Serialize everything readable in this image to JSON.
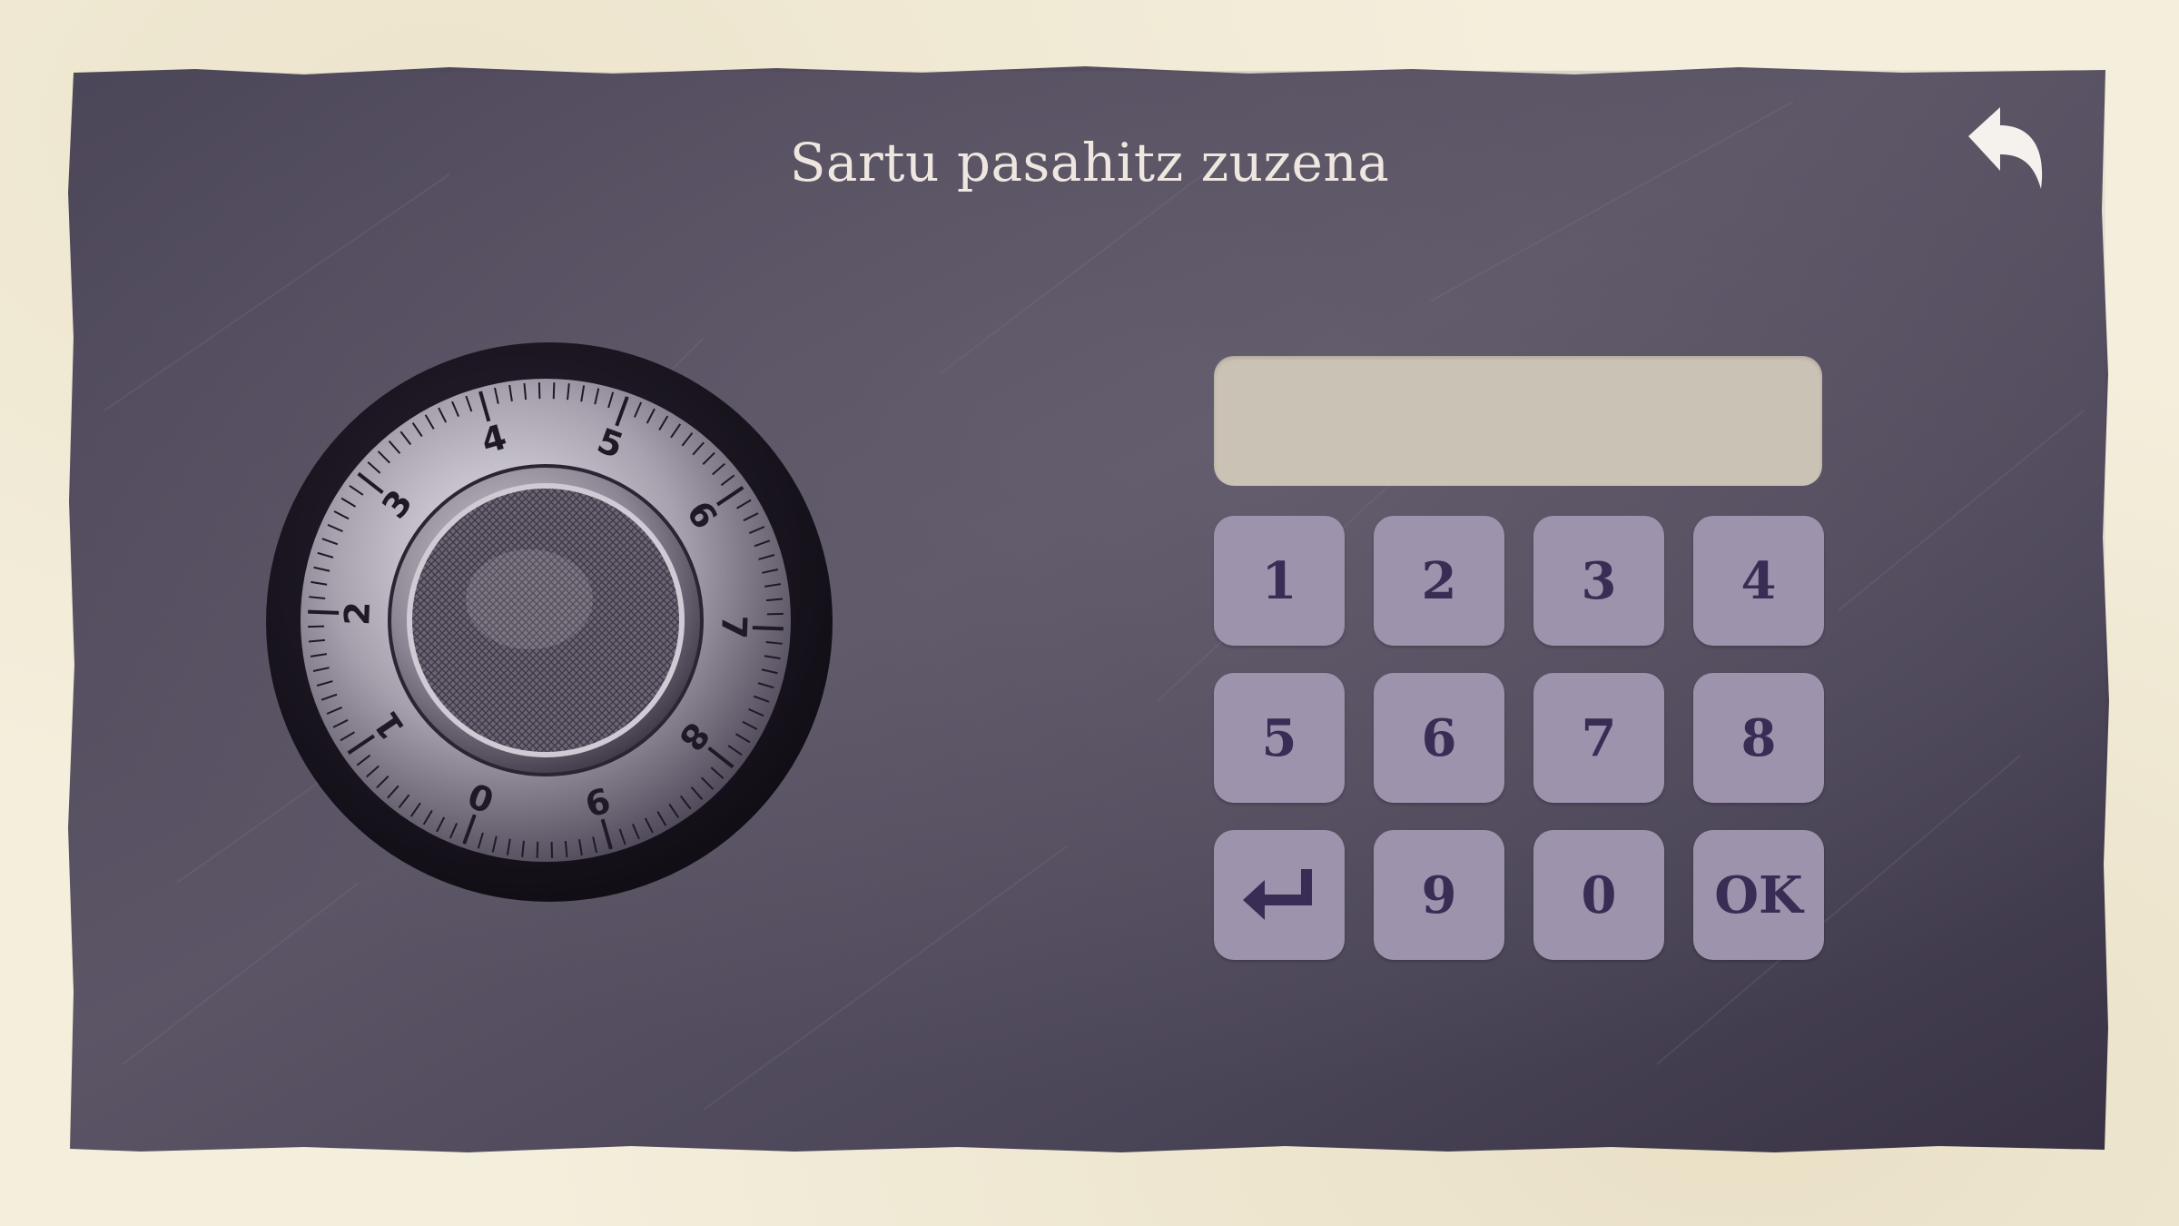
{
  "screen": {
    "title": "Sartu pasahitz zuzena",
    "back_icon": "undo-arrow-icon"
  },
  "display": {
    "value": ""
  },
  "keypad": {
    "keys": [
      {
        "label": "1",
        "name": "key-1"
      },
      {
        "label": "2",
        "name": "key-2"
      },
      {
        "label": "3",
        "name": "key-3"
      },
      {
        "label": "4",
        "name": "key-4"
      },
      {
        "label": "5",
        "name": "key-5"
      },
      {
        "label": "6",
        "name": "key-6"
      },
      {
        "label": "7",
        "name": "key-7"
      },
      {
        "label": "8",
        "name": "key-8"
      },
      {
        "label": "",
        "name": "key-backspace",
        "icon": "enter-arrow-icon"
      },
      {
        "label": "9",
        "name": "key-9"
      },
      {
        "label": "0",
        "name": "key-0"
      },
      {
        "label": "OK",
        "name": "key-ok"
      }
    ]
  },
  "dial": {
    "numbers": [
      "0",
      "1",
      "2",
      "3",
      "4",
      "5",
      "6",
      "7",
      "8",
      "9"
    ]
  },
  "colors": {
    "panel": "#4a4458",
    "paper": "#f3ecd9",
    "key": "#9d93ac",
    "key_text": "#3a2c55",
    "display": "#cbc2b6",
    "title_text": "#efe7df"
  }
}
